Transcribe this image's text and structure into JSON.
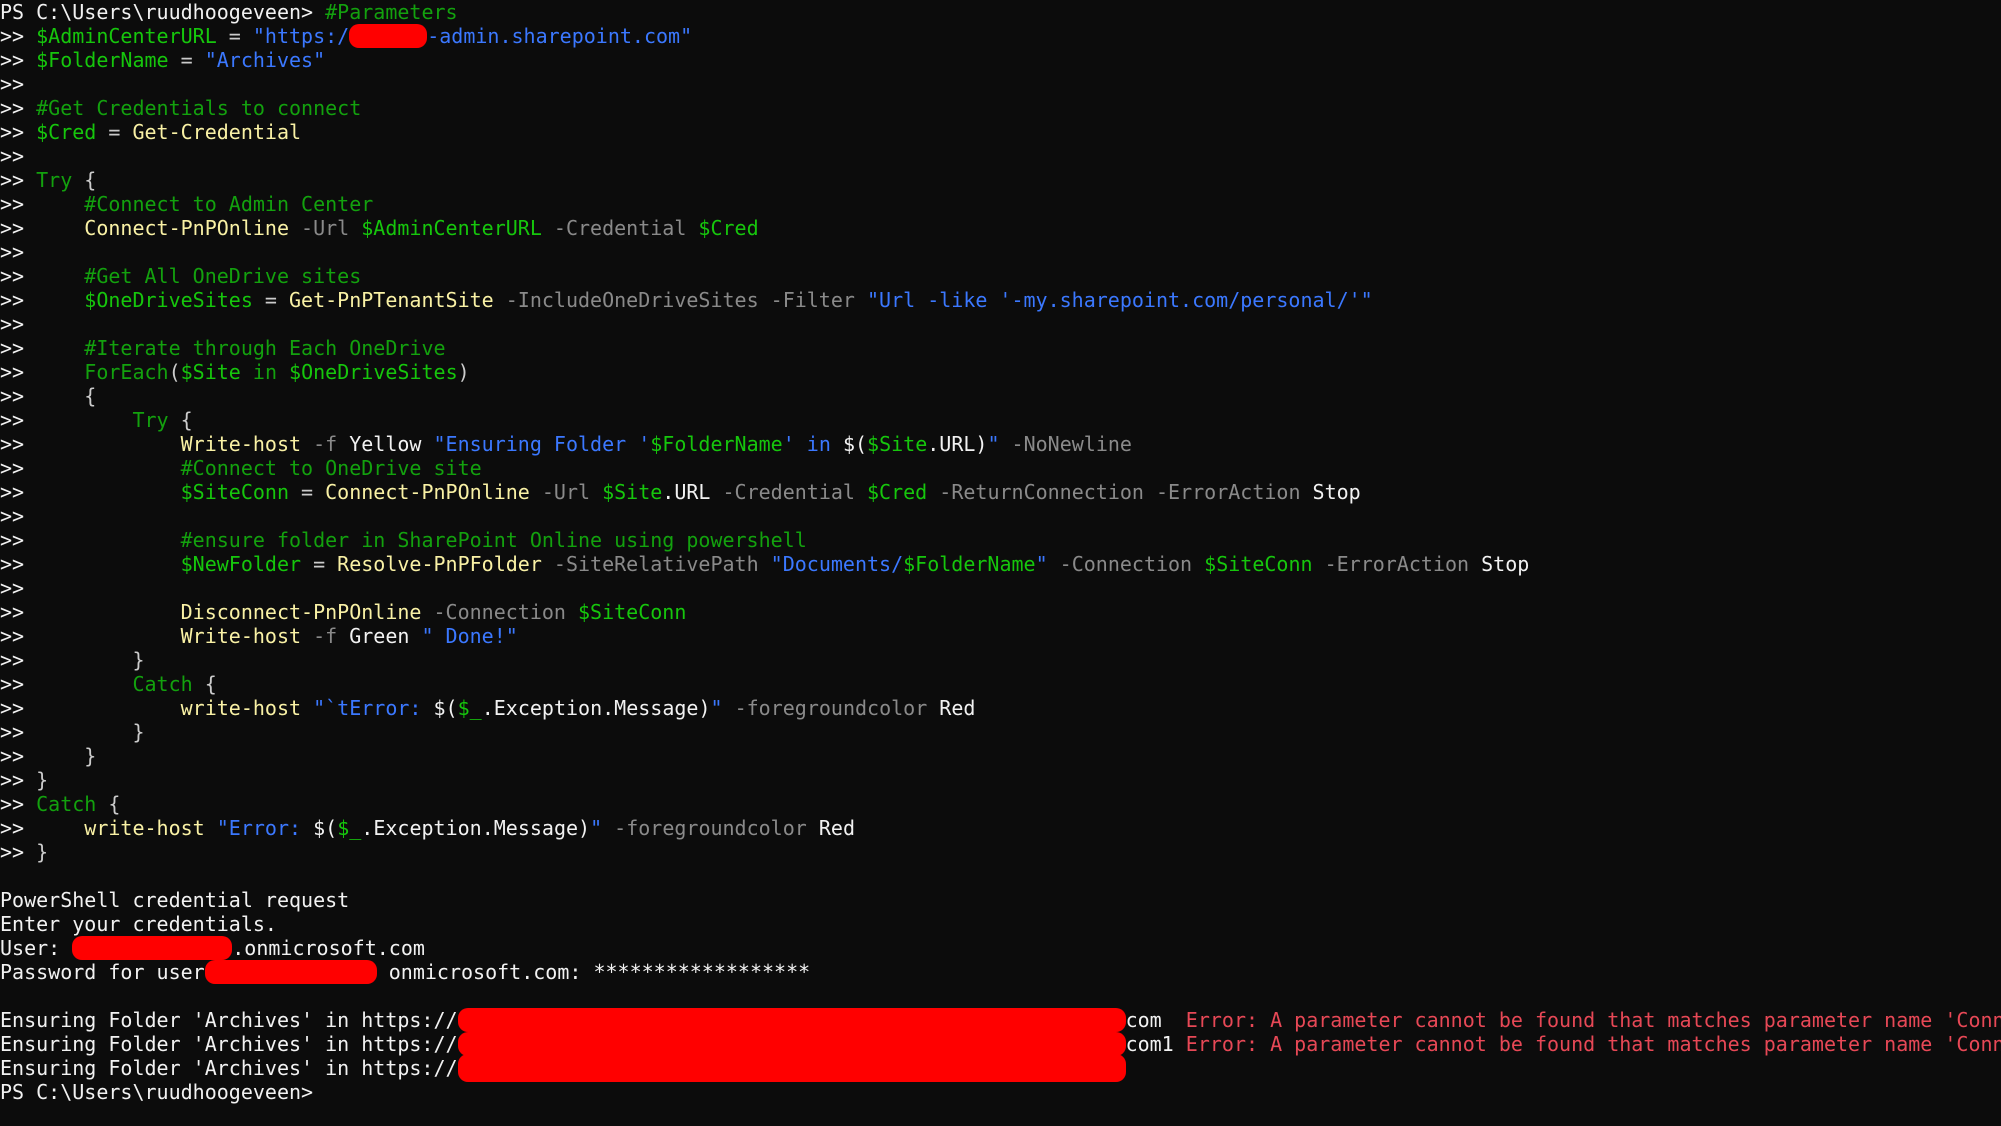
{
  "colors": {
    "background": "#0c0c0c",
    "default_text": "#cccccc",
    "comment": "#13a10e",
    "variable": "#16c60c",
    "command": "#f9f1a5",
    "parameter": "#8a8a8a",
    "string": "#3b78ff",
    "error": "#e74856",
    "redaction": "#ff0000"
  },
  "lines": [
    {
      "id": "prompt-1",
      "tokens": [
        {
          "c": "t-white",
          "t": "PS C:\\Users\\ruudhoogeveen> "
        },
        {
          "c": "t-comment",
          "t": "#Parameters"
        }
      ]
    },
    {
      "id": "admin-url",
      "tokens": [
        {
          "c": "t-white",
          "t": ">> "
        },
        {
          "c": "t-var",
          "t": "$AdminCenterURL"
        },
        {
          "c": "t-default",
          "t": " = "
        },
        {
          "c": "t-str",
          "t": "\"https:/"
        },
        {
          "redact": true,
          "w": 78
        },
        {
          "c": "t-str",
          "t": "-admin.sharepoint.com\""
        }
      ]
    },
    {
      "id": "folder-name",
      "tokens": [
        {
          "c": "t-white",
          "t": ">> "
        },
        {
          "c": "t-var",
          "t": "$FolderName"
        },
        {
          "c": "t-default",
          "t": " = "
        },
        {
          "c": "t-str",
          "t": "\"Archives\""
        }
      ]
    },
    {
      "id": "blank-1",
      "tokens": [
        {
          "c": "t-white",
          "t": ">>"
        }
      ]
    },
    {
      "id": "comment-cred",
      "tokens": [
        {
          "c": "t-white",
          "t": ">> "
        },
        {
          "c": "t-comment",
          "t": "#Get Credentials to connect"
        }
      ]
    },
    {
      "id": "cred",
      "tokens": [
        {
          "c": "t-white",
          "t": ">> "
        },
        {
          "c": "t-var",
          "t": "$Cred"
        },
        {
          "c": "t-default",
          "t": " = "
        },
        {
          "c": "t-cmd",
          "t": "Get-Credential"
        }
      ]
    },
    {
      "id": "blank-2",
      "tokens": [
        {
          "c": "t-white",
          "t": ">>"
        }
      ]
    },
    {
      "id": "try-outer",
      "tokens": [
        {
          "c": "t-white",
          "t": ">> "
        },
        {
          "c": "t-kw",
          "t": "Try"
        },
        {
          "c": "t-default",
          "t": " {"
        }
      ]
    },
    {
      "id": "comment-connect",
      "tokens": [
        {
          "c": "t-white",
          "t": ">>     "
        },
        {
          "c": "t-comment",
          "t": "#Connect to Admin Center"
        }
      ]
    },
    {
      "id": "connect-admin",
      "tokens": [
        {
          "c": "t-white",
          "t": ">>     "
        },
        {
          "c": "t-cmd",
          "t": "Connect-PnPOnline"
        },
        {
          "c": "t-param",
          "t": " -Url "
        },
        {
          "c": "t-var",
          "t": "$AdminCenterURL"
        },
        {
          "c": "t-param",
          "t": " -Credential "
        },
        {
          "c": "t-var",
          "t": "$Cred"
        }
      ]
    },
    {
      "id": "blank-3",
      "tokens": [
        {
          "c": "t-white",
          "t": ">>"
        }
      ]
    },
    {
      "id": "comment-sites",
      "tokens": [
        {
          "c": "t-white",
          "t": ">>     "
        },
        {
          "c": "t-comment",
          "t": "#Get All OneDrive sites"
        }
      ]
    },
    {
      "id": "get-sites",
      "tokens": [
        {
          "c": "t-white",
          "t": ">>     "
        },
        {
          "c": "t-var",
          "t": "$OneDriveSites"
        },
        {
          "c": "t-default",
          "t": " = "
        },
        {
          "c": "t-cmd",
          "t": "Get-PnPTenantSite"
        },
        {
          "c": "t-param",
          "t": " -IncludeOneDriveSites -Filter "
        },
        {
          "c": "t-str",
          "t": "\"Url -like '-my.sharepoint.com/personal/'\""
        }
      ]
    },
    {
      "id": "blank-4",
      "tokens": [
        {
          "c": "t-white",
          "t": ">>"
        }
      ]
    },
    {
      "id": "comment-iterate",
      "tokens": [
        {
          "c": "t-white",
          "t": ">>     "
        },
        {
          "c": "t-comment",
          "t": "#Iterate through Each OneDrive"
        }
      ]
    },
    {
      "id": "foreach",
      "tokens": [
        {
          "c": "t-white",
          "t": ">>     "
        },
        {
          "c": "t-kw",
          "t": "ForEach"
        },
        {
          "c": "t-default",
          "t": "("
        },
        {
          "c": "t-var",
          "t": "$Site"
        },
        {
          "c": "t-default",
          "t": " "
        },
        {
          "c": "t-kw",
          "t": "in"
        },
        {
          "c": "t-default",
          "t": " "
        },
        {
          "c": "t-var",
          "t": "$OneDriveSites"
        },
        {
          "c": "t-default",
          "t": ")"
        }
      ]
    },
    {
      "id": "brace-open",
      "tokens": [
        {
          "c": "t-white",
          "t": ">>     "
        },
        {
          "c": "t-default",
          "t": "{"
        }
      ]
    },
    {
      "id": "try-inner",
      "tokens": [
        {
          "c": "t-white",
          "t": ">>         "
        },
        {
          "c": "t-kw",
          "t": "Try"
        },
        {
          "c": "t-default",
          "t": " {"
        }
      ]
    },
    {
      "id": "write-ensuring",
      "tokens": [
        {
          "c": "t-white",
          "t": ">>             "
        },
        {
          "c": "t-cmd",
          "t": "Write-host"
        },
        {
          "c": "t-param",
          "t": " -f "
        },
        {
          "c": "t-bright",
          "t": "Yellow "
        },
        {
          "c": "t-str",
          "t": "\"Ensuring Folder '"
        },
        {
          "c": "t-var",
          "t": "$FolderName"
        },
        {
          "c": "t-str",
          "t": "' in "
        },
        {
          "c": "t-bright",
          "t": "$("
        },
        {
          "c": "t-var",
          "t": "$Site"
        },
        {
          "c": "t-bright",
          "t": ".URL)"
        },
        {
          "c": "t-str",
          "t": "\""
        },
        {
          "c": "t-param",
          "t": " -NoNewline"
        }
      ]
    },
    {
      "id": "comment-connect-od",
      "tokens": [
        {
          "c": "t-white",
          "t": ">>             "
        },
        {
          "c": "t-comment",
          "t": "#Connect to OneDrive site"
        }
      ]
    },
    {
      "id": "site-conn",
      "tokens": [
        {
          "c": "t-white",
          "t": ">>             "
        },
        {
          "c": "t-var",
          "t": "$SiteConn"
        },
        {
          "c": "t-default",
          "t": " = "
        },
        {
          "c": "t-cmd",
          "t": "Connect-PnPOnline"
        },
        {
          "c": "t-param",
          "t": " -Url "
        },
        {
          "c": "t-var",
          "t": "$Site"
        },
        {
          "c": "t-bright",
          "t": ".URL"
        },
        {
          "c": "t-param",
          "t": " -Credential "
        },
        {
          "c": "t-var",
          "t": "$Cred"
        },
        {
          "c": "t-param",
          "t": " -ReturnConnection -ErrorAction "
        },
        {
          "c": "t-bright",
          "t": "Stop"
        }
      ]
    },
    {
      "id": "blank-5",
      "tokens": [
        {
          "c": "t-white",
          "t": ">>"
        }
      ]
    },
    {
      "id": "comment-ensure",
      "tokens": [
        {
          "c": "t-white",
          "t": ">>             "
        },
        {
          "c": "t-comment",
          "t": "#ensure folder in SharePoint Online using powershell"
        }
      ]
    },
    {
      "id": "new-folder",
      "tokens": [
        {
          "c": "t-white",
          "t": ">>             "
        },
        {
          "c": "t-var",
          "t": "$NewFolder"
        },
        {
          "c": "t-default",
          "t": " = "
        },
        {
          "c": "t-cmd",
          "t": "Resolve-PnPFolder"
        },
        {
          "c": "t-param",
          "t": " -SiteRelativePath "
        },
        {
          "c": "t-str",
          "t": "\"Documents/"
        },
        {
          "c": "t-var",
          "t": "$FolderName"
        },
        {
          "c": "t-str",
          "t": "\""
        },
        {
          "c": "t-param",
          "t": " -Connection "
        },
        {
          "c": "t-var",
          "t": "$SiteConn"
        },
        {
          "c": "t-param",
          "t": " -ErrorAction "
        },
        {
          "c": "t-bright",
          "t": "Stop"
        }
      ]
    },
    {
      "id": "blank-6",
      "tokens": [
        {
          "c": "t-white",
          "t": ">>"
        }
      ]
    },
    {
      "id": "disconnect",
      "tokens": [
        {
          "c": "t-white",
          "t": ">>             "
        },
        {
          "c": "t-cmd",
          "t": "Disconnect-PnPOnline"
        },
        {
          "c": "t-param",
          "t": " -Connection "
        },
        {
          "c": "t-var",
          "t": "$SiteConn"
        }
      ]
    },
    {
      "id": "write-done",
      "tokens": [
        {
          "c": "t-white",
          "t": ">>             "
        },
        {
          "c": "t-cmd",
          "t": "Write-host"
        },
        {
          "c": "t-param",
          "t": " -f "
        },
        {
          "c": "t-bright",
          "t": "Green "
        },
        {
          "c": "t-str",
          "t": "\" Done!\""
        }
      ]
    },
    {
      "id": "brace-close-try",
      "tokens": [
        {
          "c": "t-white",
          "t": ">>         "
        },
        {
          "c": "t-default",
          "t": "}"
        }
      ]
    },
    {
      "id": "catch-inner",
      "tokens": [
        {
          "c": "t-white",
          "t": ">>         "
        },
        {
          "c": "t-kw",
          "t": "Catch"
        },
        {
          "c": "t-default",
          "t": " {"
        }
      ]
    },
    {
      "id": "write-error-inner",
      "tokens": [
        {
          "c": "t-white",
          "t": ">>             "
        },
        {
          "c": "t-cmd",
          "t": "write-host"
        },
        {
          "c": "t-default",
          "t": " "
        },
        {
          "c": "t-str",
          "t": "\"`tError: "
        },
        {
          "c": "t-bright",
          "t": "$("
        },
        {
          "c": "t-var",
          "t": "$_"
        },
        {
          "c": "t-bright",
          "t": ".Exception.Message)"
        },
        {
          "c": "t-str",
          "t": "\""
        },
        {
          "c": "t-param",
          "t": " -foregroundcolor "
        },
        {
          "c": "t-bright",
          "t": "Red"
        }
      ]
    },
    {
      "id": "brace-close-catch",
      "tokens": [
        {
          "c": "t-white",
          "t": ">>         "
        },
        {
          "c": "t-default",
          "t": "}"
        }
      ]
    },
    {
      "id": "brace-close-foreach",
      "tokens": [
        {
          "c": "t-white",
          "t": ">>     "
        },
        {
          "c": "t-default",
          "t": "}"
        }
      ]
    },
    {
      "id": "brace-close-outer",
      "tokens": [
        {
          "c": "t-white",
          "t": ">> "
        },
        {
          "c": "t-default",
          "t": "}"
        }
      ]
    },
    {
      "id": "catch-outer",
      "tokens": [
        {
          "c": "t-white",
          "t": ">> "
        },
        {
          "c": "t-kw",
          "t": "Catch"
        },
        {
          "c": "t-default",
          "t": " {"
        }
      ]
    },
    {
      "id": "write-error-outer",
      "tokens": [
        {
          "c": "t-white",
          "t": ">>     "
        },
        {
          "c": "t-cmd",
          "t": "write-host"
        },
        {
          "c": "t-default",
          "t": " "
        },
        {
          "c": "t-str",
          "t": "\"Error: "
        },
        {
          "c": "t-bright",
          "t": "$("
        },
        {
          "c": "t-var",
          "t": "$_"
        },
        {
          "c": "t-bright",
          "t": ".Exception.Message)"
        },
        {
          "c": "t-str",
          "t": "\""
        },
        {
          "c": "t-param",
          "t": " -foregroundcolor "
        },
        {
          "c": "t-bright",
          "t": "Red"
        }
      ]
    },
    {
      "id": "brace-close-final",
      "tokens": [
        {
          "c": "t-white",
          "t": ">> "
        },
        {
          "c": "t-default",
          "t": "}"
        }
      ]
    },
    {
      "id": "blank-7",
      "tokens": []
    },
    {
      "id": "cred-request",
      "tokens": [
        {
          "c": "t-white",
          "t": "PowerShell credential request"
        }
      ]
    },
    {
      "id": "enter-creds",
      "tokens": [
        {
          "c": "t-white",
          "t": "Enter your credentials."
        }
      ]
    },
    {
      "id": "user-line",
      "tokens": [
        {
          "c": "t-white",
          "t": "User: "
        },
        {
          "redact": true,
          "w": 160
        },
        {
          "c": "t-white",
          "t": ".onmicrosoft.com"
        }
      ]
    },
    {
      "id": "password-line",
      "tokens": [
        {
          "c": "t-white",
          "t": "Password for user"
        },
        {
          "redact": true,
          "w": 172
        },
        {
          "c": "t-white",
          "t": " onmicrosoft.com: ******************"
        }
      ]
    },
    {
      "id": "blank-8",
      "tokens": []
    },
    {
      "id": "output-1",
      "tokens": [
        {
          "c": "t-white",
          "t": "Ensuring Folder 'Archives' in https://"
        },
        {
          "redact": true,
          "w": 668
        },
        {
          "c": "t-white",
          "t": "com  "
        },
        {
          "c": "t-err",
          "t": "Error: A parameter cannot be found that matches parameter name 'Connection'."
        }
      ]
    },
    {
      "id": "output-2",
      "tokens": [
        {
          "c": "t-white",
          "t": "Ensuring Folder 'Archives' in https://"
        },
        {
          "redact": true,
          "w": 668
        },
        {
          "c": "t-white",
          "t": "com1 "
        },
        {
          "c": "t-err",
          "t": "Error: A parameter cannot be found that matches parameter name 'Connection'."
        }
      ]
    },
    {
      "id": "output-3",
      "tokens": [
        {
          "c": "t-white",
          "t": "Ensuring Folder 'Archives' in https://"
        },
        {
          "redact": true,
          "w": 668,
          "tall": true
        }
      ]
    },
    {
      "id": "prompt-final",
      "tokens": [
        {
          "c": "t-white",
          "t": "PS C:\\Users\\ruudhoogeveen>"
        }
      ]
    }
  ]
}
